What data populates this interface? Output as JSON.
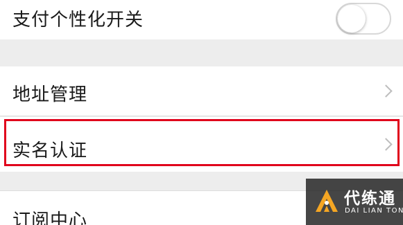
{
  "settings": {
    "payment_personalization": {
      "label": "支付个性化开关",
      "toggle_state": "off"
    },
    "address_management": {
      "label": "地址管理",
      "icon": "chevron-right-icon"
    },
    "real_name_verification": {
      "label": "实名认证",
      "icon": "chevron-right-icon",
      "highlighted": true,
      "highlight_color": "#e0001b"
    },
    "subscription_center": {
      "label": "订阅中心"
    }
  },
  "watermark": {
    "title": "代练通",
    "subtitle": "DAI LIAN TONG",
    "logo_color": "#f5a623"
  }
}
